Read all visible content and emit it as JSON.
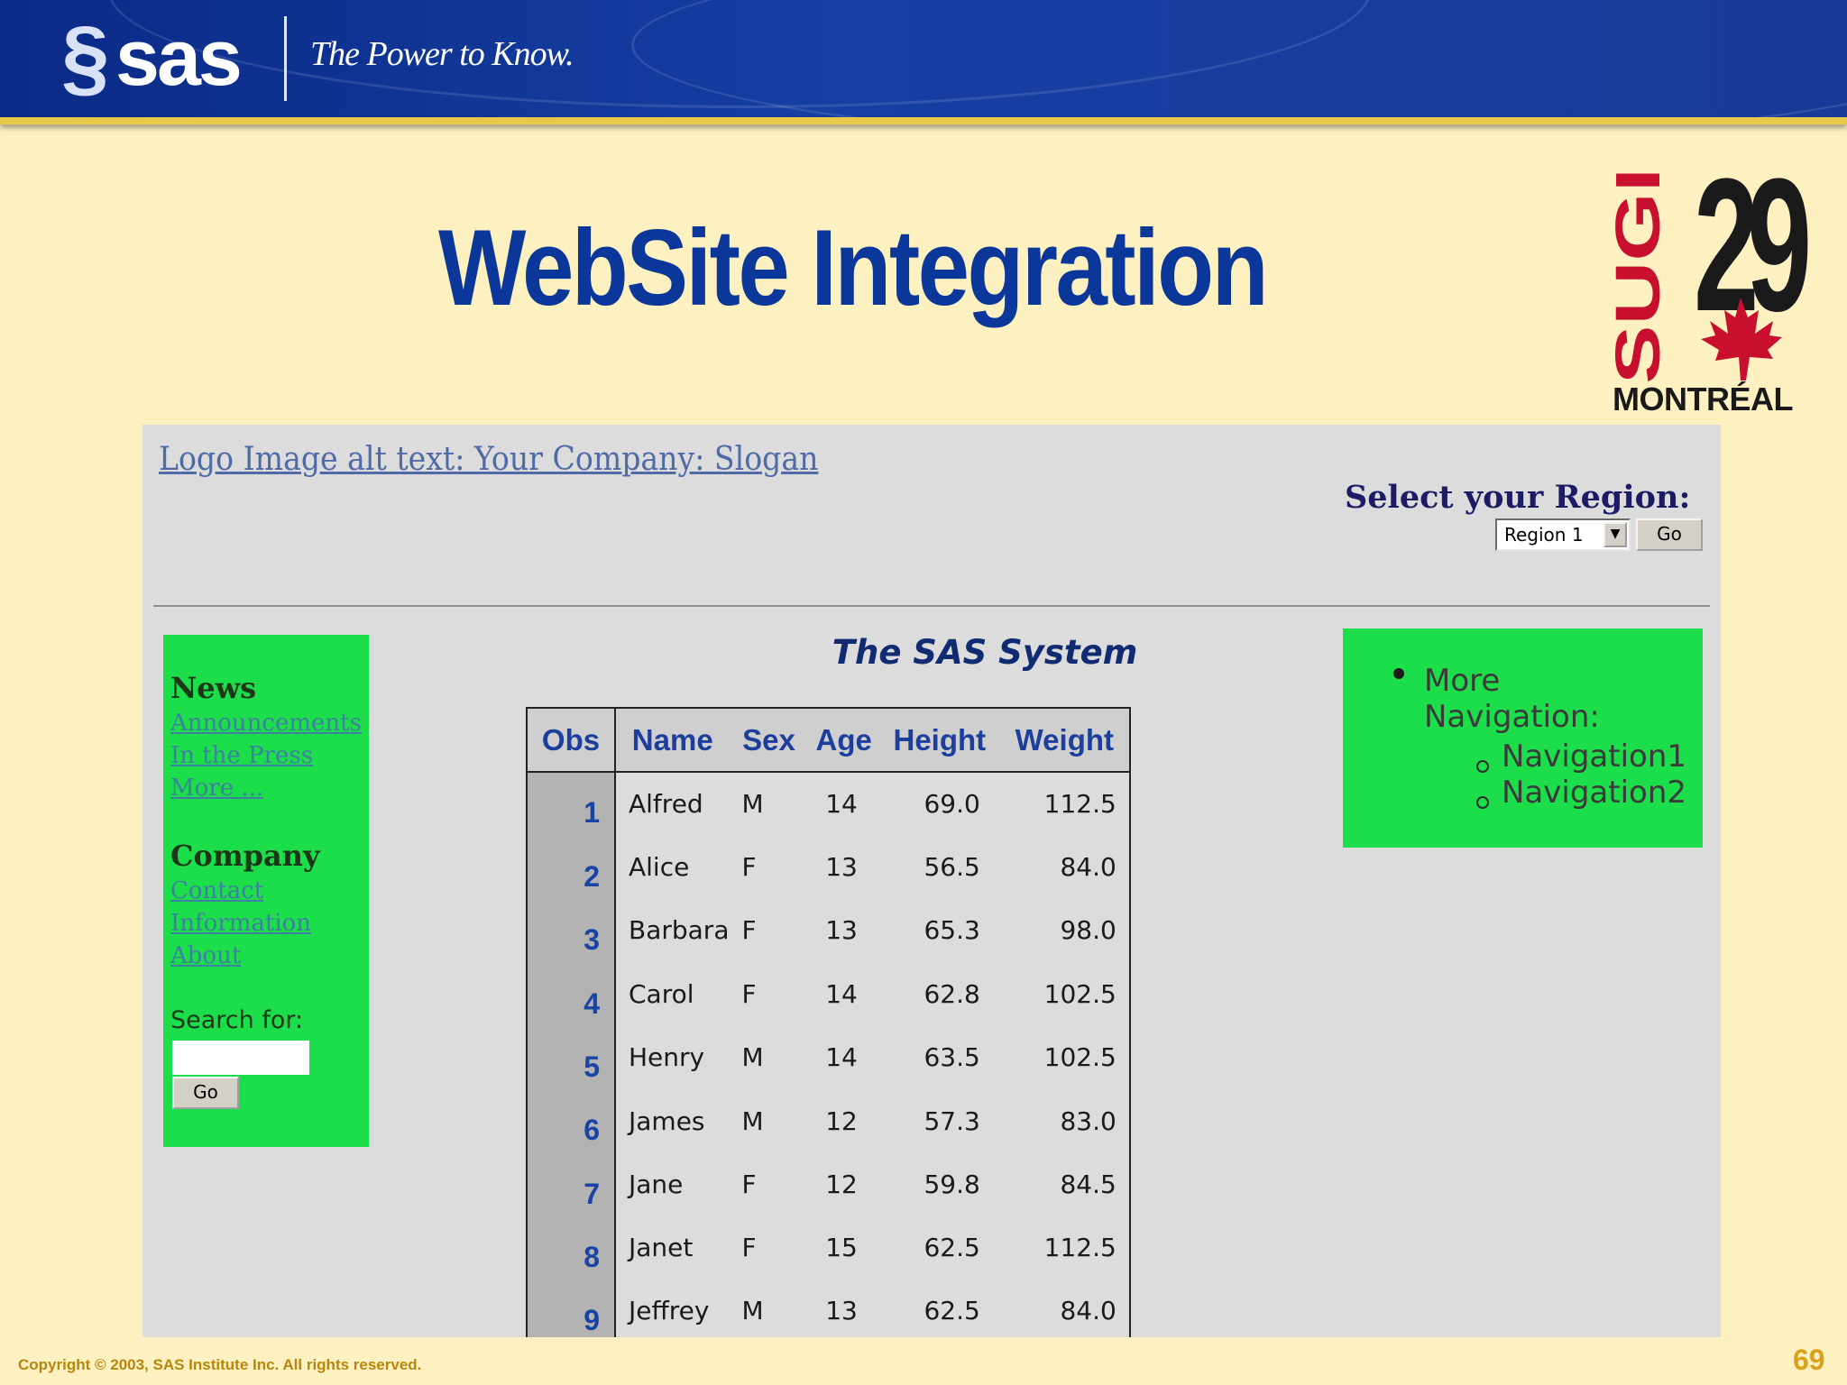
{
  "header": {
    "brand": "sas",
    "tagline": "The Power to Know."
  },
  "conference_logo": {
    "event": "SUGI",
    "number": "29",
    "city": "MONTRÉAL",
    "accent_color": "#c8102e"
  },
  "slide": {
    "title": "WebSite Integration",
    "copyright": "Copyright © 2003, SAS Institute Inc. All rights reserved.",
    "page_number": "69"
  },
  "webpage": {
    "logo_alt_text": "Logo Image alt text: Your Company: Slogan",
    "region": {
      "label": "Select your Region:",
      "selected": "Region 1",
      "go_label": "Go"
    },
    "left_nav": {
      "sections": [
        {
          "heading": "News",
          "links": [
            "Announcements",
            "In the Press",
            "More ..."
          ]
        },
        {
          "heading": "Company",
          "links": [
            "Contact",
            "Information",
            "About"
          ]
        }
      ],
      "search_label": "Search for:",
      "search_value": "",
      "go_label": "Go"
    },
    "report": {
      "title": "The SAS System",
      "columns": [
        "Obs",
        "Name",
        "Sex",
        "Age",
        "Height",
        "Weight"
      ],
      "rows": [
        [
          "1",
          "Alfred",
          "M",
          "14",
          "69.0",
          "112.5"
        ],
        [
          "2",
          "Alice",
          "F",
          "13",
          "56.5",
          "84.0"
        ],
        [
          "3",
          "Barbara",
          "F",
          "13",
          "65.3",
          "98.0"
        ],
        [
          "4",
          "Carol",
          "F",
          "14",
          "62.8",
          "102.5"
        ],
        [
          "5",
          "Henry",
          "M",
          "14",
          "63.5",
          "102.5"
        ],
        [
          "6",
          "James",
          "M",
          "12",
          "57.3",
          "83.0"
        ],
        [
          "7",
          "Jane",
          "F",
          "12",
          "59.8",
          "84.5"
        ],
        [
          "8",
          "Janet",
          "F",
          "15",
          "62.5",
          "112.5"
        ],
        [
          "9",
          "Jeffrey",
          "M",
          "13",
          "62.5",
          "84.0"
        ]
      ]
    },
    "right_nav": {
      "item": "More Navigation:",
      "sub_items": [
        "Navigation1",
        "Navigation2"
      ]
    }
  }
}
